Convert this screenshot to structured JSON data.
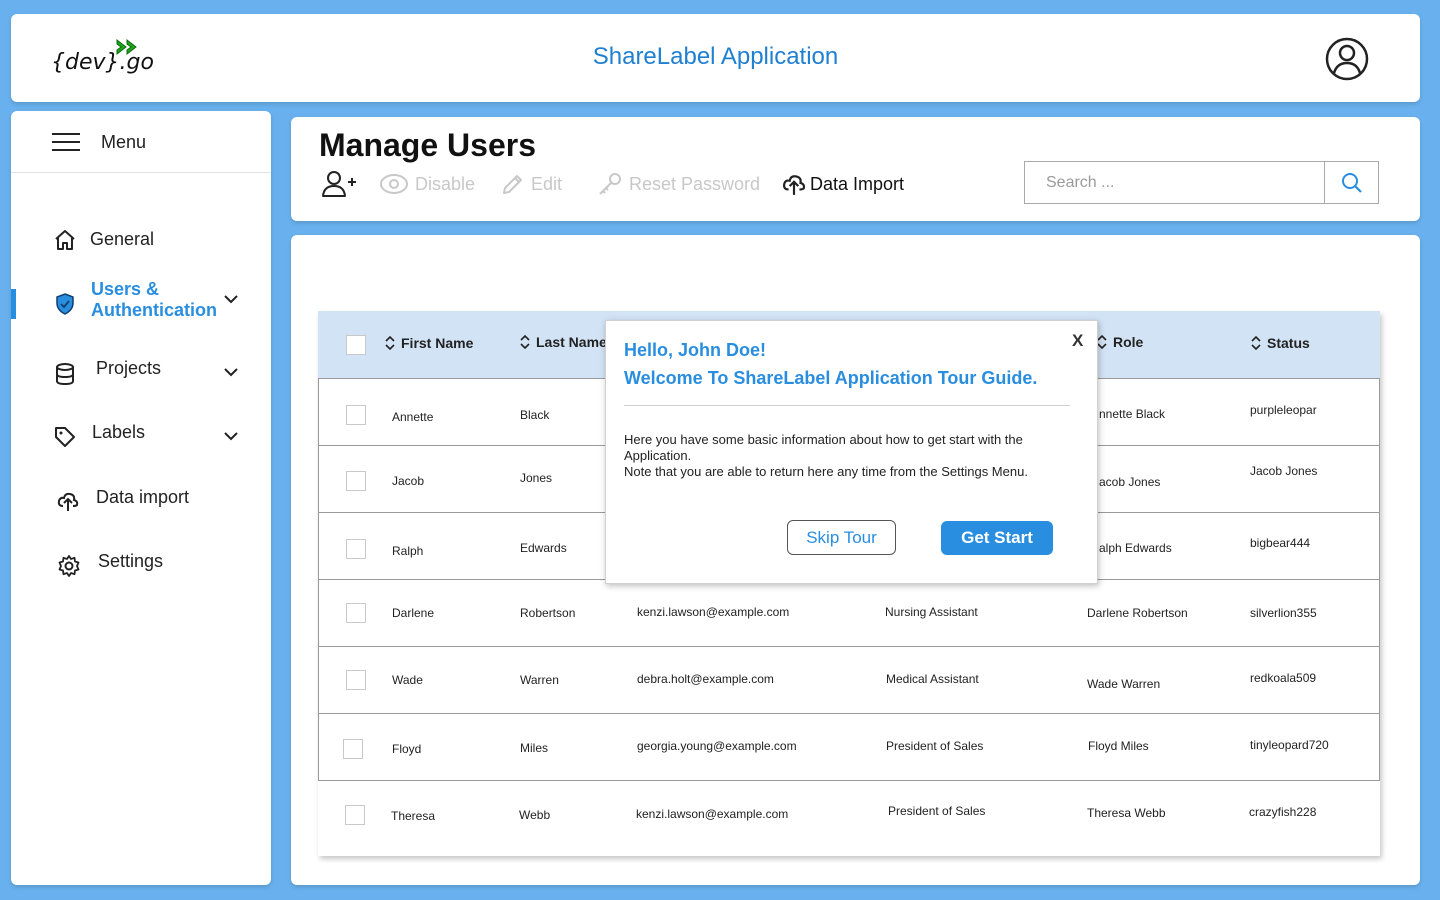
{
  "header": {
    "logo_text": "{dev}.go",
    "app_title": "ShareLabel Application"
  },
  "sidebar": {
    "menu_label": "Menu",
    "items": [
      {
        "label": "General",
        "icon": "home-icon"
      },
      {
        "label_line1": "Users &",
        "label_line2": "Authentication",
        "icon": "shield-icon",
        "active": true
      },
      {
        "label": "Projects",
        "icon": "database-icon"
      },
      {
        "label": "Labels",
        "icon": "tag-icon"
      },
      {
        "label": "Data import",
        "icon": "cloud-upload-icon"
      },
      {
        "label": "Settings",
        "icon": "gear-icon"
      }
    ]
  },
  "toolbar": {
    "page_title": "Manage Users",
    "disable_label": "Disable",
    "edit_label": "Edit",
    "reset_password_label": "Reset Password",
    "data_import_label": "Data Import",
    "search_placeholder": "Search ..."
  },
  "table": {
    "columns": {
      "first_name": "First Name",
      "last_name": "Last Name",
      "role": "Role",
      "status": "Status"
    },
    "rows": [
      {
        "first": "Annette",
        "last": "Black",
        "email": "",
        "job": "",
        "role": "nnette Black",
        "status": "purpleleopar"
      },
      {
        "first": "Jacob",
        "last": "Jones",
        "email": "",
        "job": "",
        "role": "acob Jones",
        "status": "Jacob Jones"
      },
      {
        "first": "Ralph",
        "last": "Edwards",
        "email": "",
        "job": "",
        "role": "alph Edwards",
        "status": "bigbear444"
      },
      {
        "first": "Darlene",
        "last": "Robertson",
        "email": "kenzi.lawson@example.com",
        "job": "Nursing Assistant",
        "role": "Darlene Robertson",
        "status": "silverlion355"
      },
      {
        "first": "Wade",
        "last": "Warren",
        "email": "debra.holt@example.com",
        "job": "Medical Assistant",
        "role": "Wade Warren",
        "status": "redkoala509"
      },
      {
        "first": "Floyd",
        "last": "Miles",
        "email": "georgia.young@example.com",
        "job": "President of Sales",
        "role": "Floyd Miles",
        "status": "tinyleopard720"
      },
      {
        "first": "Theresa",
        "last": "Webb",
        "email": "kenzi.lawson@example.com",
        "job": "President of Sales",
        "role": "Theresa Webb",
        "status": "crazyfish228"
      }
    ]
  },
  "tour": {
    "close_label": "X",
    "hello": "Hello, John Doe!",
    "welcome": "Welcome To ShareLabel Application Tour Guide.",
    "body_line1": "Here you have some basic information about how to get start with the",
    "body_line2": "Application.",
    "body_line3": "Note that you are able to return here any time from the Settings Menu.",
    "skip_label": "Skip Tour",
    "start_label": "Get Start"
  },
  "colors": {
    "background": "#69b1ee",
    "accent": "#2a8ee0",
    "table_header": "#d2e3f5",
    "logo_arrows": "#1ea51e"
  }
}
